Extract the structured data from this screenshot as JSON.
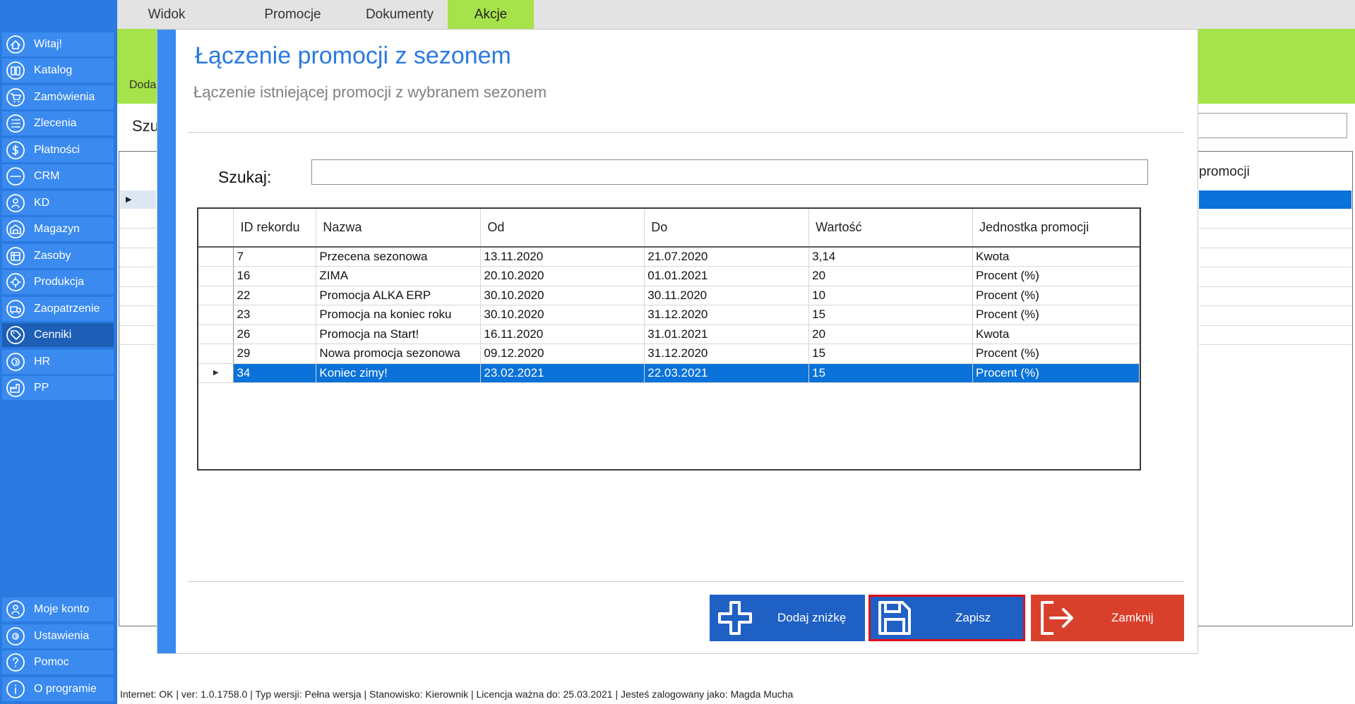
{
  "sidebar": {
    "items": [
      {
        "label": "Witaj!",
        "icon": "home-icon"
      },
      {
        "label": "Katalog",
        "icon": "book-icon"
      },
      {
        "label": "Zamówienia",
        "icon": "cart-icon"
      },
      {
        "label": "Zlecenia",
        "icon": "list-icon"
      },
      {
        "label": "Płatności",
        "icon": "dollar-icon"
      },
      {
        "label": "CRM",
        "icon": "crm-icon"
      },
      {
        "label": "KD",
        "icon": "user-icon"
      },
      {
        "label": "Magazyn",
        "icon": "warehouse-icon"
      },
      {
        "label": "Zasoby",
        "icon": "resources-icon"
      },
      {
        "label": "Produkcja",
        "icon": "gear-icon"
      },
      {
        "label": "Zaopatrzenie",
        "icon": "truck-icon"
      },
      {
        "label": "Cenniki",
        "icon": "tag-icon",
        "active": true
      },
      {
        "label": "HR",
        "icon": "hr-icon"
      },
      {
        "label": "PP",
        "icon": "factory-icon"
      }
    ],
    "bottom_items": [
      {
        "label": "Moje konto",
        "icon": "account-icon"
      },
      {
        "label": "Ustawienia",
        "icon": "settings-icon"
      },
      {
        "label": "Pomoc",
        "icon": "help-icon"
      },
      {
        "label": "O programie",
        "icon": "info-icon"
      }
    ]
  },
  "topbar": {
    "tabs": [
      {
        "label": "Widok"
      },
      {
        "label": "Promocje"
      },
      {
        "label": "Dokumenty"
      },
      {
        "label": "Akcje",
        "active": true
      }
    ]
  },
  "background": {
    "ribbon_partial": "Doda",
    "search_partial": "Szu",
    "column_partial": "promocji"
  },
  "modal": {
    "title": "Łączenie promocji z sezonem",
    "subtitle": "Łączenie istniejącej promocji z wybranem sezonem",
    "search_label": "Szukaj:",
    "search_value": "",
    "grid": {
      "columns": [
        "ID rekordu",
        "Nazwa",
        "Od",
        "Do",
        "Wartość",
        "Jednostka promocji"
      ],
      "rows": [
        {
          "id": "7",
          "nazwa": "Przecena sezonowa",
          "od": "13.11.2020",
          "do": "21.07.2020",
          "wartosc": "3,14",
          "jednostka": "Kwota"
        },
        {
          "id": "16",
          "nazwa": "ZIMA",
          "od": "20.10.2020",
          "do": "01.01.2021",
          "wartosc": "20",
          "jednostka": "Procent (%)"
        },
        {
          "id": "22",
          "nazwa": "Promocja ALKA ERP",
          "od": "30.10.2020",
          "do": "30.11.2020",
          "wartosc": "10",
          "jednostka": "Procent (%)"
        },
        {
          "id": "23",
          "nazwa": "Promocja na koniec roku",
          "od": "30.10.2020",
          "do": "31.12.2020",
          "wartosc": "15",
          "jednostka": "Procent (%)"
        },
        {
          "id": "26",
          "nazwa": "Promocja na Start!",
          "od": "16.11.2020",
          "do": "31.01.2021",
          "wartosc": "20",
          "jednostka": "Kwota"
        },
        {
          "id": "29",
          "nazwa": "Nowa promocja sezonowa",
          "od": "09.12.2020",
          "do": "31.12.2020",
          "wartosc": "15",
          "jednostka": "Procent (%)"
        },
        {
          "id": "34",
          "nazwa": "Koniec zimy!",
          "od": "23.02.2021",
          "do": "22.03.2021",
          "wartosc": "15",
          "jednostka": "Procent (%)",
          "selected": true
        }
      ]
    },
    "buttons": {
      "add": {
        "label": "Dodaj zniżkę",
        "icon": "plus-icon"
      },
      "save": {
        "label": "Zapisz",
        "icon": "floppy-disk-icon"
      },
      "close": {
        "label": "Zamknij",
        "icon": "exit-icon"
      }
    }
  },
  "statusbar": {
    "text": "Internet: OK  |   ver: 1.0.1758.0   |   Typ wersji: Pełna wersja   |   Stanowisko: Kierownik   |   Licencja ważna do: 25.03.2021   |   Jesteś zalogowany jako: Magda Mucha"
  },
  "colors": {
    "sidebar": "#2a7ae2",
    "sidebar_item": "#3a8aef",
    "ribbon": "#a6e24a",
    "accent_blue": "#1f60c4",
    "selection": "#0a72d8",
    "close_red": "#d9402c",
    "highlight_outline": "#e0101a"
  }
}
